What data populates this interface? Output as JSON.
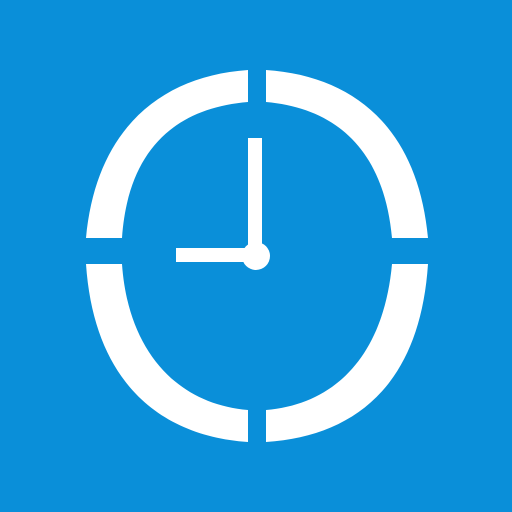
{
  "app_icon": {
    "icon": "clock-icon",
    "background_color": "#0a8fd9",
    "foreground_color": "#ffffff",
    "clock": {
      "time_shown": "9:00"
    }
  }
}
